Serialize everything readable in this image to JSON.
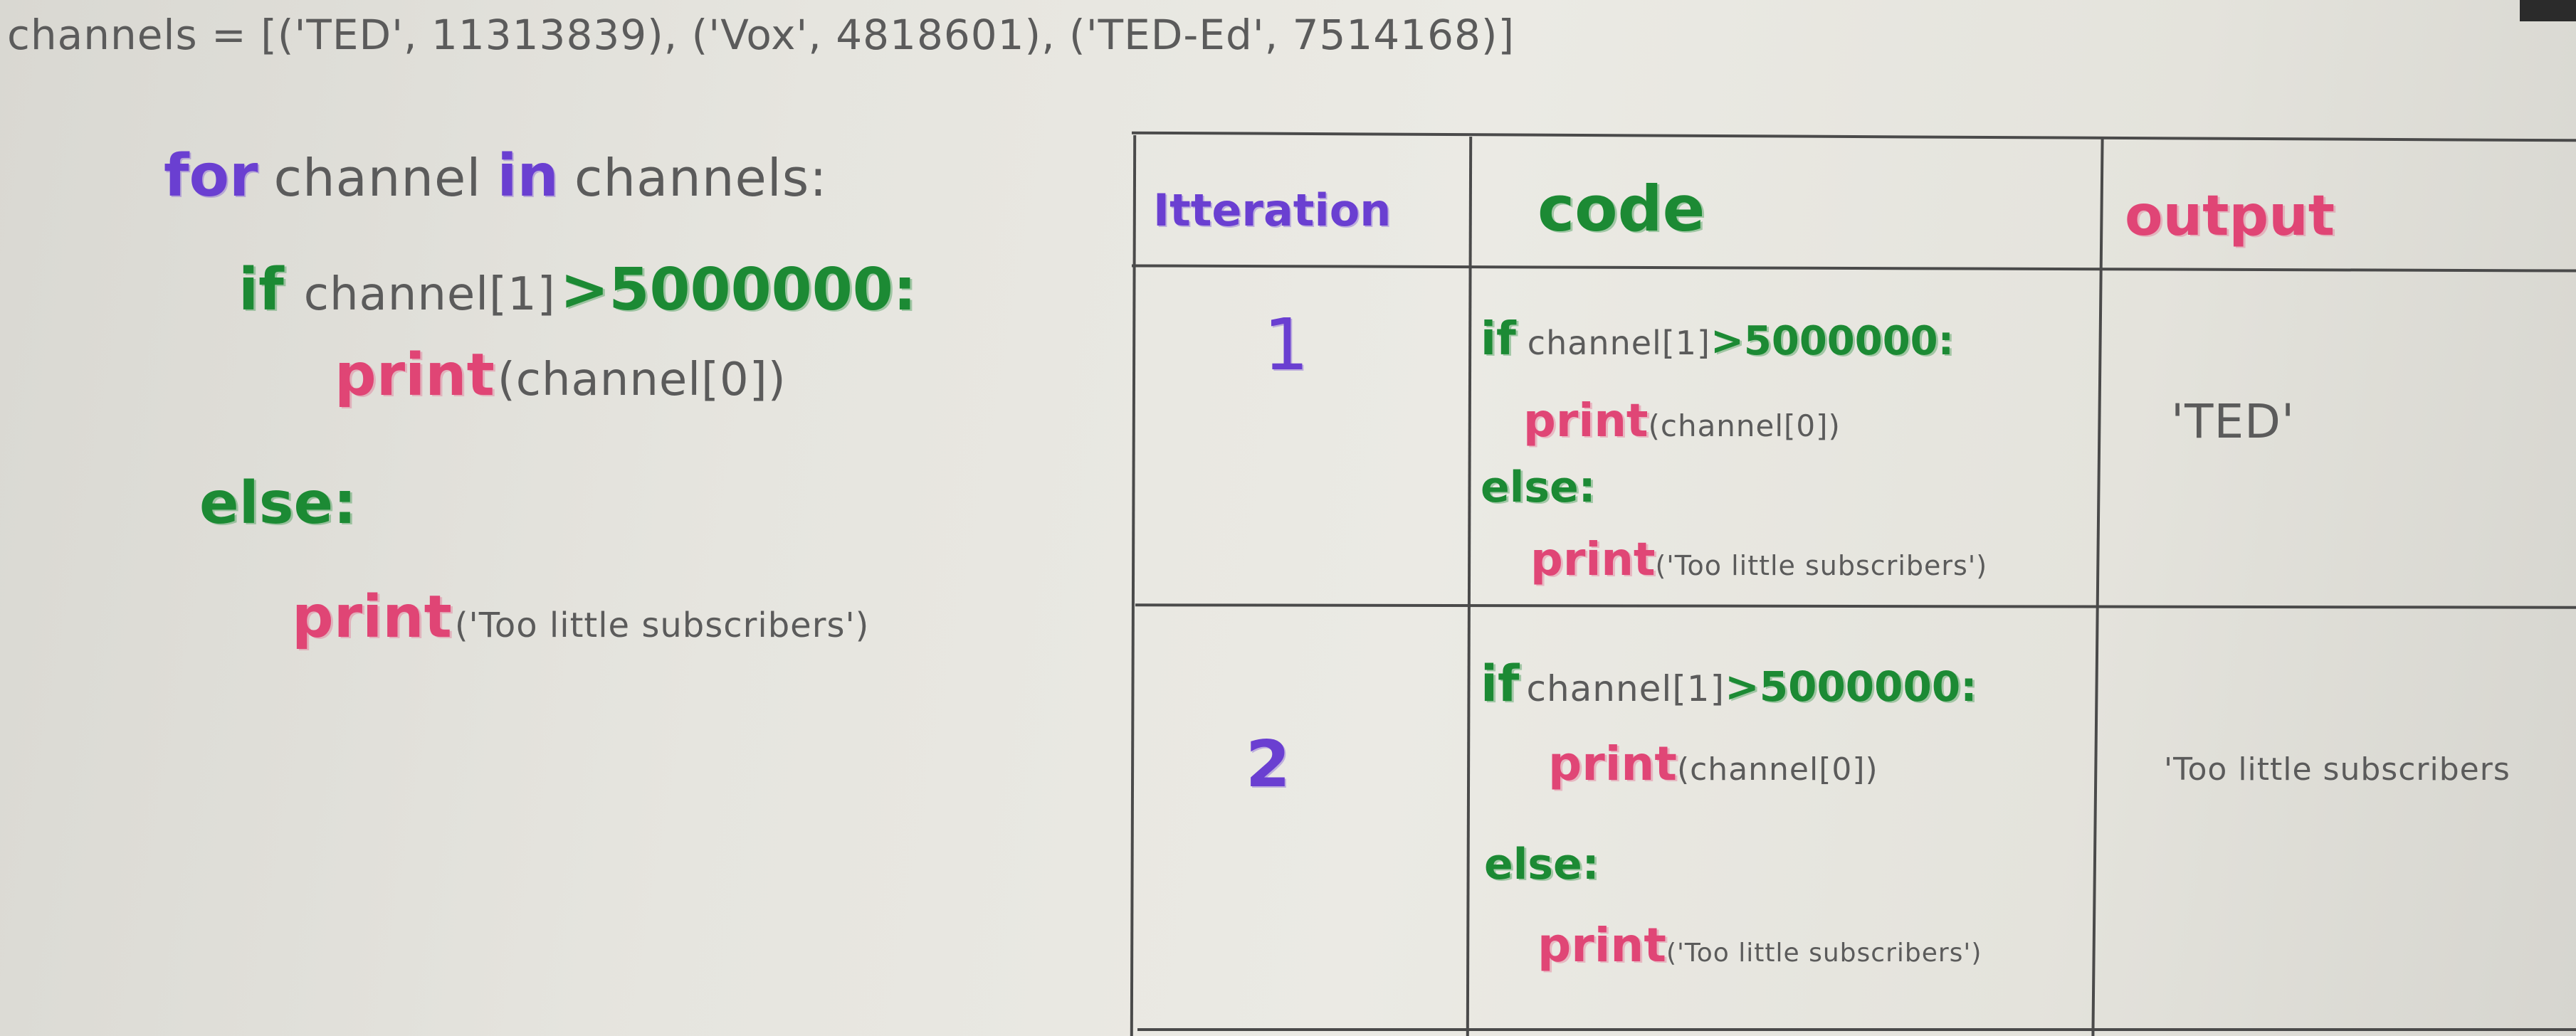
{
  "channels_line": "channels = [('TED', 11313839), ('Vox', 4818601), ('TED-Ed', 7514168)]",
  "code": {
    "for_kw": "for",
    "for_var": "channel",
    "in_kw": "in",
    "for_iter": "channels:",
    "if_kw": "if",
    "if_expr": "channel[1]",
    "if_cmp": ">5000000:",
    "print_kw": "print",
    "print_arg": "(channel[0])",
    "else_kw": "else:",
    "print2_kw": "print",
    "print2_arg": "('Too little subscribers')"
  },
  "table": {
    "headers": [
      "Itteration",
      "code",
      "output"
    ],
    "rows": [
      {
        "iteration": "1",
        "if_kw": "if",
        "if_expr": "channel[1]",
        "if_cmp": ">5000000:",
        "print_kw": "print",
        "print_arg": "(channel[0])",
        "else_kw": "else:",
        "print2_kw": "print",
        "print2_arg": "('Too little subscribers')",
        "output": "'TED'"
      },
      {
        "iteration": "2",
        "if_kw": "if",
        "if_expr": "channel[1]",
        "if_cmp": ">5000000:",
        "print_kw": "print",
        "print_arg": "(channel[0])",
        "else_kw": "else:",
        "print2_kw": "print",
        "print2_arg": "('Too little subscribers')",
        "output": "'Too little subscribers"
      }
    ]
  },
  "colors": {
    "purple": "#6a3fd1",
    "green": "#1c8a34",
    "pink": "#e0356b",
    "pencil": "#5b5b5b"
  }
}
